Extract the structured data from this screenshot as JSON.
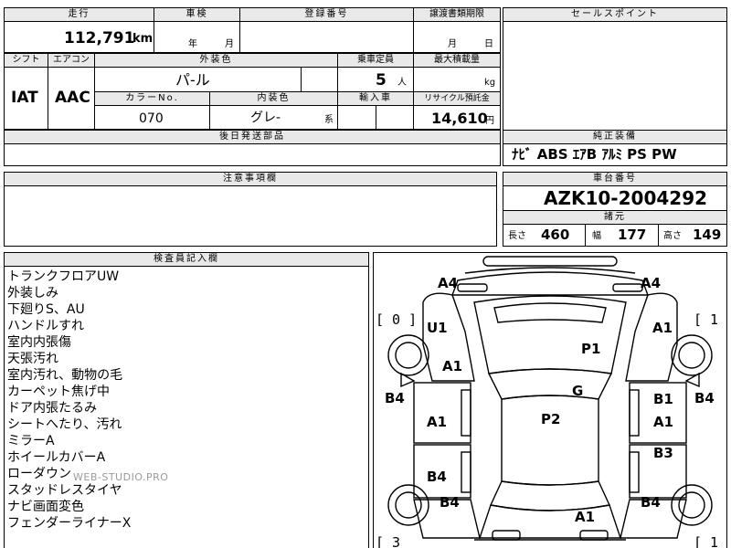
{
  "top": {
    "mileage_label": "走行",
    "mileage_value": "112,791",
    "mileage_unit": "km",
    "inspection_label": "車検",
    "inspection_year": "年",
    "inspection_month": "月",
    "registration_label": "登録番号",
    "transfer_label": "譲渡書類期限",
    "transfer_month": "月",
    "transfer_day": "日"
  },
  "spec": {
    "shift_label": "シフト",
    "shift_value": "IAT",
    "ac_label": "エアコン",
    "ac_value": "AAC",
    "exterior_label": "外装色",
    "exterior_value": "パ-ル",
    "capacity_label": "乗車定員",
    "capacity_value": "5",
    "capacity_unit": "人",
    "load_label": "最大積載量",
    "load_unit": "kg",
    "color_no_label": "カラーNo.",
    "color_no_value": "070",
    "interior_label": "内装色",
    "interior_value": "グレ-",
    "interior_suffix": "系",
    "import_label": "輸入車",
    "recycle_label": "リサイクル預託金",
    "recycle_value": "14,610",
    "recycle_unit": "円",
    "later_parts_label": "後日発送部品"
  },
  "sales": {
    "label": "セールスポイント"
  },
  "equipment": {
    "label": "純正装備",
    "value": "ﾅﾋﾞ ABS ｴｱB ｱﾙﾐ PS PW"
  },
  "notes": {
    "label": "注意事項欄"
  },
  "chassis": {
    "label": "車台番号",
    "value": "AZK10-2004292",
    "specs_label": "諸元",
    "length_label": "長さ",
    "length_value": "460",
    "width_label": "幅",
    "width_value": "177",
    "height_label": "高さ",
    "height_value": "149"
  },
  "inspector": {
    "label": "検査員記入欄",
    "items": [
      "トランクフロアUW",
      "外装しみ",
      "下廻りS、AU",
      "ハンドルすれ",
      "室内内張傷",
      "天張汚れ",
      "室内汚れ、動物の毛",
      "カーペット焦げ中",
      "ドア内張たるみ",
      "シートへたり、汚れ",
      "ミラーA",
      "ホイールカバーA",
      "ローダウン",
      "スタッドレスタイヤ",
      "ナビ画面変色",
      "フェンダーライナーX"
    ],
    "watermark": "WEB-STUDIO.PRO"
  },
  "diagram": {
    "bracket_left_top": "[ 0 ]",
    "bracket_right_top": "[ 1 ]",
    "bracket_left_bottom": "[ 3",
    "bracket_right_bottom": "[ 1",
    "marks": {
      "a4_left": "A4",
      "a4_right": "A4",
      "u1": "U1",
      "a1_front_right": "A1",
      "p1": "P1",
      "a1_front_left": "A1",
      "b4_left": "B4",
      "b4_right": "B4",
      "g": "G",
      "b1": "B1",
      "a1_door_left": "A1",
      "p2": "P2",
      "a1_door_right": "A1",
      "b3": "B3",
      "b4_rear_door": "B4",
      "b4_rear_left": "B4",
      "b4_rear_right": "B4",
      "a1_rear": "A1"
    }
  }
}
